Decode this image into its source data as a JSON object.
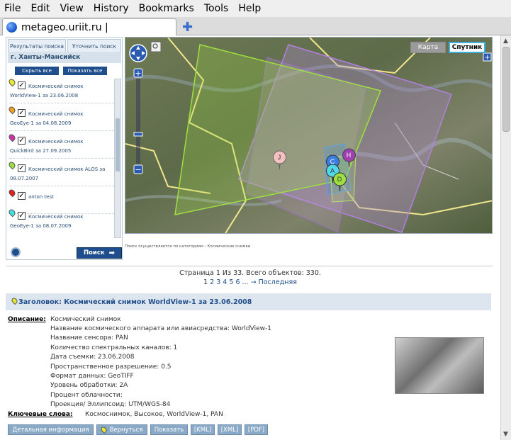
{
  "menu": [
    "File",
    "Edit",
    "View",
    "History",
    "Bookmarks",
    "Tools",
    "Help"
  ],
  "tab": {
    "title": "metageo.uriit.ru |"
  },
  "left_panel": {
    "tabs": [
      "Результаты поиска",
      "Уточнить поиск"
    ],
    "region": "г. Ханты-Мансийск",
    "hide_all": "Скрыть все",
    "show_all": "Показать все",
    "items": [
      {
        "title": "Космический снимок",
        "subtitle": "WorldView-1 за 23.06.2008",
        "pin_color": "#e8e830"
      },
      {
        "title": "Космический снимок",
        "subtitle": "GeoEye-1 за 04.08.2009",
        "pin_color": "#f0a020"
      },
      {
        "title": "Космический снимок",
        "subtitle": "QuickBird за 27.09.2005",
        "pin_color": "#d030a0"
      },
      {
        "title": "Космический снимок ALOS за",
        "subtitle": "08.07.2007",
        "pin_color": "#9ee040"
      },
      {
        "title": "anton test",
        "subtitle": "",
        "pin_color": "#e02020"
      },
      {
        "title": "Космический снимок",
        "subtitle": "GeoEye-1 за 08.07.2009",
        "pin_color": "#40e0e0"
      }
    ],
    "search_button": "Поиск"
  },
  "map": {
    "type_map": "Карта",
    "type_satellite": "Спутник",
    "markers": [
      "J",
      "H",
      "C",
      "A",
      "D"
    ]
  },
  "notice": "Поиск осуществляется по категориям : Космические снимки",
  "pager": {
    "summary": "Страница 1 Из 33. Всего объектов: 330.",
    "current": "1",
    "pages": [
      "2",
      "3",
      "4",
      "5",
      "6",
      "...",
      "→ Последняя"
    ]
  },
  "result": {
    "header": "Заголовок: Космический снимок WorldView-1 за 23.06.2008",
    "description_label": "Описание:",
    "description_lines": [
      "Космический снимок",
      "Название космического аппарата или авиасредства: WorldView-1",
      "Название сенсора: PAN",
      "Количество спектральных каналов: 1",
      "Дата съемки: 23.06.2008",
      "Пространственное разрешение: 0.5",
      "Формат данных: GeoTIFF",
      "Уровень обработки: 2A",
      "Процент облачности:",
      "Проекция/ Эллипсоид: UTM/WGS-84"
    ],
    "keywords_label": "Ключевые слова:",
    "keywords": "Космоснимок, Высокое, WorldView-1, PAN"
  },
  "actions": [
    "Детальная информация",
    "Вернуться",
    "Показать",
    "[KML]",
    "[XML]",
    "[PDF]"
  ]
}
